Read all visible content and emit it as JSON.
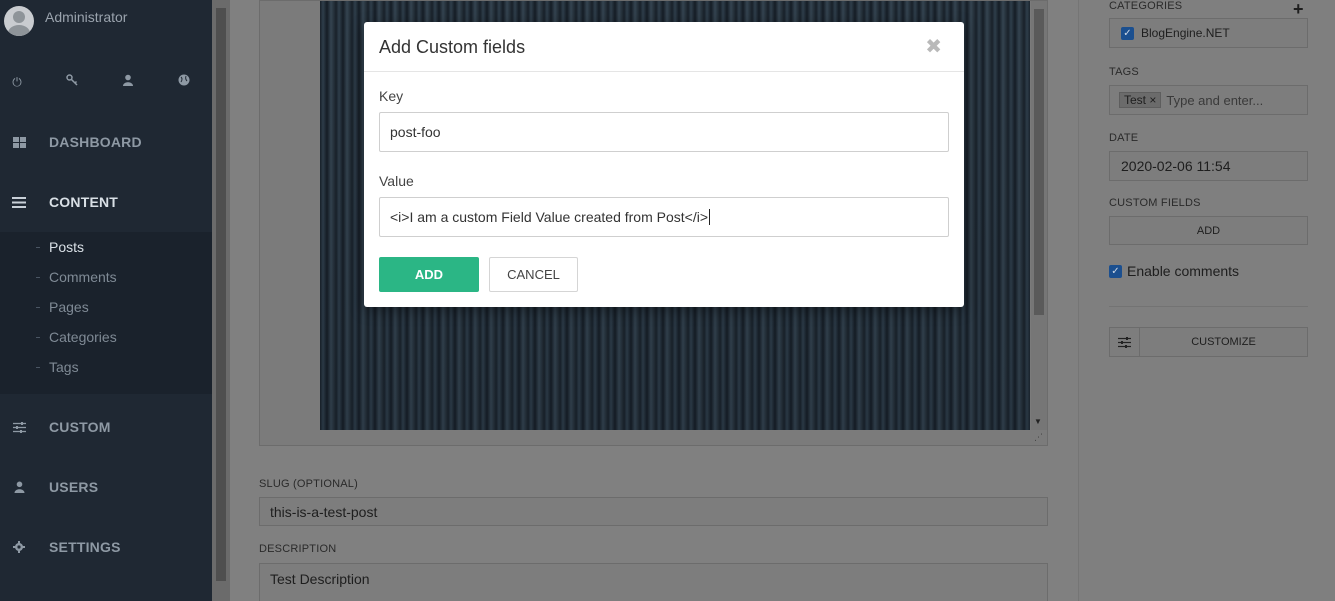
{
  "sidebar": {
    "user_name": "Administrator",
    "nav": {
      "dashboard": "DASHBOARD",
      "content": "CONTENT",
      "custom": "CUSTOM",
      "users": "USERS",
      "settings": "SETTINGS"
    },
    "content_items": [
      "Posts",
      "Comments",
      "Pages",
      "Categories",
      "Tags"
    ]
  },
  "editor": {
    "slug_label": "SLUG (OPTIONAL)",
    "slug_value": "this-is-a-test-post",
    "description_label": "DESCRIPTION",
    "description_value": "Test Description"
  },
  "right_panel": {
    "categories_label": "CATEGORIES",
    "category": "BlogEngine.NET",
    "tags_label": "TAGS",
    "tag": "Test",
    "tag_remove": "×",
    "tags_placeholder": "Type and enter...",
    "date_label": "DATE",
    "date_value": "2020-02-06 11:54",
    "custom_fields_label": "CUSTOM FIELDS",
    "custom_fields_add": "ADD",
    "enable_comments": "Enable comments",
    "customize": "CUSTOMIZE"
  },
  "modal": {
    "title": "Add Custom fields",
    "close_glyph": "✖",
    "key_label": "Key",
    "key_value": "post-foo",
    "value_label": "Value",
    "value_value": "<i>I am a custom Field Value created from Post</i>",
    "add_button": "ADD",
    "cancel_button": "CANCEL"
  },
  "colors": {
    "sidebar_bg": "#1f2833",
    "accent_green": "#2bb685",
    "checkbox_blue": "#1b4f8f"
  }
}
